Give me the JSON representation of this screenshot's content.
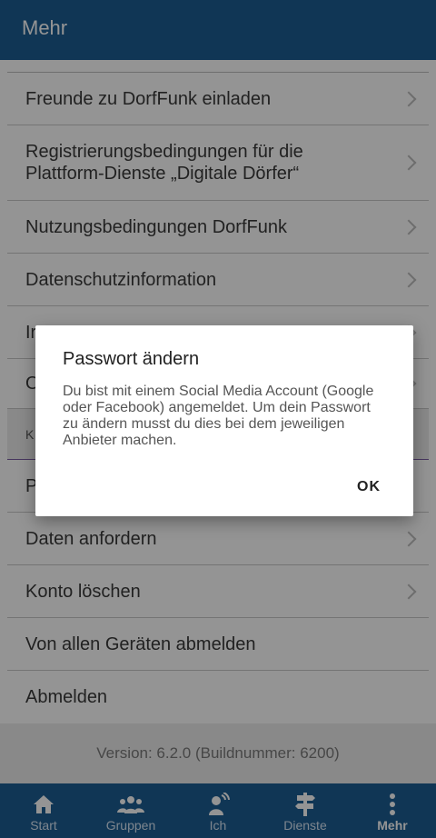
{
  "header": {
    "title": "Mehr"
  },
  "menu": {
    "invite": "Freunde zu DorfFunk einladen",
    "registration": "Registrierungsbedingungen für die Plattform-Dienste „Digitale Dörfer“",
    "terms": "Nutzungsbedingungen DorfFunk",
    "privacy": "Datenschutzinformation",
    "imprint_partial": "Ir",
    "other_partial": "O",
    "section_partial": "K",
    "password_partial": "P",
    "request_data": "Daten anfordern",
    "delete_account": "Konto löschen",
    "logout_all": "Von allen Geräten abmelden",
    "logout": "Abmelden"
  },
  "version": "Version: 6.2.0 (Buildnummer: 6200)",
  "nav": {
    "items": [
      "Start",
      "Gruppen",
      "Ich",
      "Dienste",
      "Mehr"
    ],
    "icons": [
      "home-icon",
      "groups-icon",
      "person-broadcast-icon",
      "signpost-icon",
      "more-vertical-icon"
    ],
    "active": "Mehr"
  },
  "dialog": {
    "title": "Passwort ändern",
    "message": "Du bist mit einem Social Media Account (Google oder Facebook) angemeldet. Um dein Passwort zu ändern musst du dies bei dem jeweiligen Anbieter machen.",
    "ok": "OK"
  },
  "colors": {
    "primary": "#1c5e93",
    "overlay": "rgba(0,0,0,0.42)"
  }
}
